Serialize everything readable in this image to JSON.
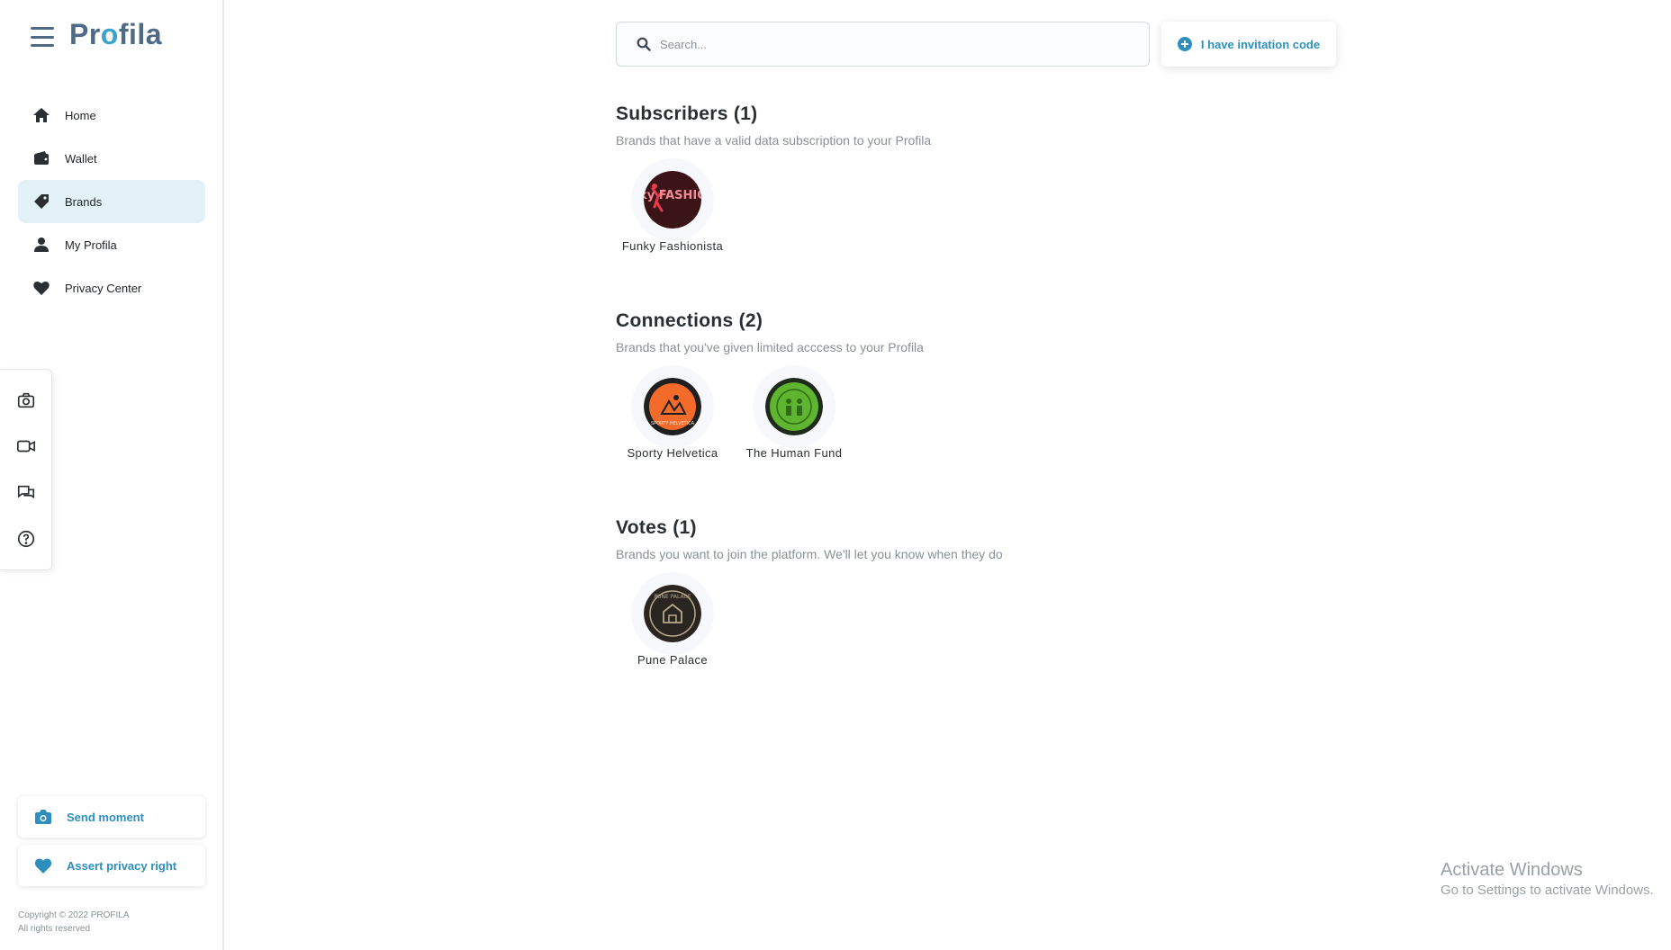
{
  "app": {
    "logo_pre": "Pr",
    "logo_o": "o",
    "logo_post": "fila"
  },
  "sidebar": {
    "items": [
      {
        "label": "Home",
        "icon": "home-icon",
        "active": false
      },
      {
        "label": "Wallet",
        "icon": "wallet-icon",
        "active": false
      },
      {
        "label": "Brands",
        "icon": "tag-icon",
        "active": true
      },
      {
        "label": "My Profila",
        "icon": "user-icon",
        "active": false
      },
      {
        "label": "Privacy Center",
        "icon": "heart-shield-icon",
        "active": false
      }
    ],
    "tools": [
      "camera-icon",
      "video-icon",
      "chat-icon",
      "help-icon"
    ],
    "send_moment": "Send moment",
    "assert_privacy": "Assert privacy right",
    "copyright_line1": "Copyright © 2022 PROFILA",
    "copyright_line2": "All rights reserved"
  },
  "search": {
    "placeholder": "Search...",
    "value": ""
  },
  "invite": {
    "label": "I have invitation code"
  },
  "sections": {
    "subscribers": {
      "title": "Subscribers (1)",
      "description": "Brands that have a valid data subscription to your Profila",
      "brands": [
        {
          "name": "Funky Fashionista",
          "logo_text": "FuNky FASHIONISTA"
        }
      ]
    },
    "connections": {
      "title": "Connections (2)",
      "description": "Brands that you've given limited acccess to your Profila",
      "brands": [
        {
          "name": "Sporty Helvetica",
          "logo_text": "SPORTY HELVETICA"
        },
        {
          "name": "The Human Fund"
        }
      ]
    },
    "votes": {
      "title": "Votes (1)",
      "description": "Brands you want to join the platform. We'll let you know when they do",
      "brands": [
        {
          "name": "Pune Palace",
          "logo_text": "PUNE PALACE"
        }
      ]
    }
  },
  "watermark": {
    "line1": "Activate Windows",
    "line2": "Go to Settings to activate Windows."
  },
  "colors": {
    "accent": "#2e8fbf",
    "logo": "#4f6a86",
    "active_bg": "#e3f1f8"
  }
}
